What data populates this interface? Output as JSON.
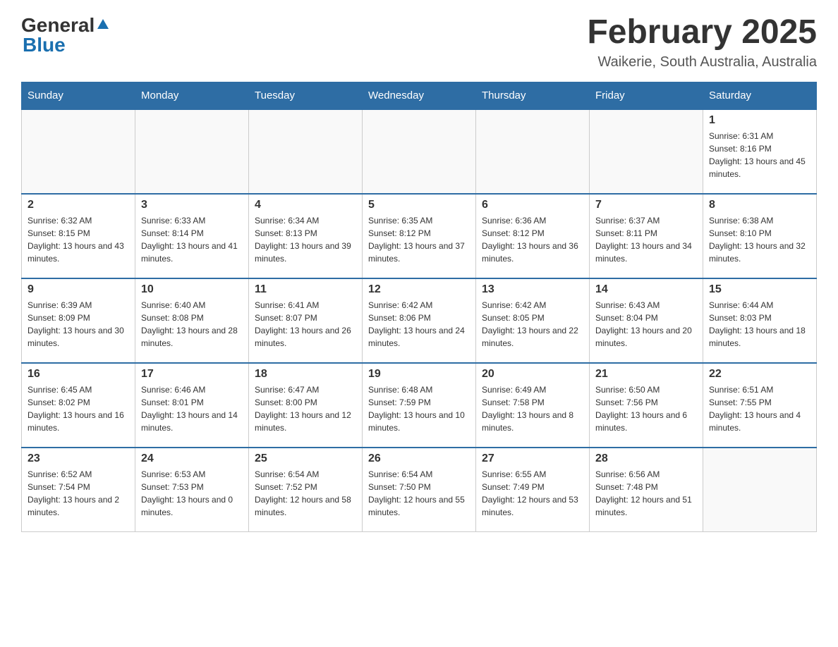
{
  "header": {
    "logo_general": "General",
    "logo_blue": "Blue",
    "month_title": "February 2025",
    "location": "Waikerie, South Australia, Australia"
  },
  "days_of_week": [
    "Sunday",
    "Monday",
    "Tuesday",
    "Wednesday",
    "Thursday",
    "Friday",
    "Saturday"
  ],
  "weeks": [
    [
      {
        "day": "",
        "info": ""
      },
      {
        "day": "",
        "info": ""
      },
      {
        "day": "",
        "info": ""
      },
      {
        "day": "",
        "info": ""
      },
      {
        "day": "",
        "info": ""
      },
      {
        "day": "",
        "info": ""
      },
      {
        "day": "1",
        "info": "Sunrise: 6:31 AM\nSunset: 8:16 PM\nDaylight: 13 hours and 45 minutes."
      }
    ],
    [
      {
        "day": "2",
        "info": "Sunrise: 6:32 AM\nSunset: 8:15 PM\nDaylight: 13 hours and 43 minutes."
      },
      {
        "day": "3",
        "info": "Sunrise: 6:33 AM\nSunset: 8:14 PM\nDaylight: 13 hours and 41 minutes."
      },
      {
        "day": "4",
        "info": "Sunrise: 6:34 AM\nSunset: 8:13 PM\nDaylight: 13 hours and 39 minutes."
      },
      {
        "day": "5",
        "info": "Sunrise: 6:35 AM\nSunset: 8:12 PM\nDaylight: 13 hours and 37 minutes."
      },
      {
        "day": "6",
        "info": "Sunrise: 6:36 AM\nSunset: 8:12 PM\nDaylight: 13 hours and 36 minutes."
      },
      {
        "day": "7",
        "info": "Sunrise: 6:37 AM\nSunset: 8:11 PM\nDaylight: 13 hours and 34 minutes."
      },
      {
        "day": "8",
        "info": "Sunrise: 6:38 AM\nSunset: 8:10 PM\nDaylight: 13 hours and 32 minutes."
      }
    ],
    [
      {
        "day": "9",
        "info": "Sunrise: 6:39 AM\nSunset: 8:09 PM\nDaylight: 13 hours and 30 minutes."
      },
      {
        "day": "10",
        "info": "Sunrise: 6:40 AM\nSunset: 8:08 PM\nDaylight: 13 hours and 28 minutes."
      },
      {
        "day": "11",
        "info": "Sunrise: 6:41 AM\nSunset: 8:07 PM\nDaylight: 13 hours and 26 minutes."
      },
      {
        "day": "12",
        "info": "Sunrise: 6:42 AM\nSunset: 8:06 PM\nDaylight: 13 hours and 24 minutes."
      },
      {
        "day": "13",
        "info": "Sunrise: 6:42 AM\nSunset: 8:05 PM\nDaylight: 13 hours and 22 minutes."
      },
      {
        "day": "14",
        "info": "Sunrise: 6:43 AM\nSunset: 8:04 PM\nDaylight: 13 hours and 20 minutes."
      },
      {
        "day": "15",
        "info": "Sunrise: 6:44 AM\nSunset: 8:03 PM\nDaylight: 13 hours and 18 minutes."
      }
    ],
    [
      {
        "day": "16",
        "info": "Sunrise: 6:45 AM\nSunset: 8:02 PM\nDaylight: 13 hours and 16 minutes."
      },
      {
        "day": "17",
        "info": "Sunrise: 6:46 AM\nSunset: 8:01 PM\nDaylight: 13 hours and 14 minutes."
      },
      {
        "day": "18",
        "info": "Sunrise: 6:47 AM\nSunset: 8:00 PM\nDaylight: 13 hours and 12 minutes."
      },
      {
        "day": "19",
        "info": "Sunrise: 6:48 AM\nSunset: 7:59 PM\nDaylight: 13 hours and 10 minutes."
      },
      {
        "day": "20",
        "info": "Sunrise: 6:49 AM\nSunset: 7:58 PM\nDaylight: 13 hours and 8 minutes."
      },
      {
        "day": "21",
        "info": "Sunrise: 6:50 AM\nSunset: 7:56 PM\nDaylight: 13 hours and 6 minutes."
      },
      {
        "day": "22",
        "info": "Sunrise: 6:51 AM\nSunset: 7:55 PM\nDaylight: 13 hours and 4 minutes."
      }
    ],
    [
      {
        "day": "23",
        "info": "Sunrise: 6:52 AM\nSunset: 7:54 PM\nDaylight: 13 hours and 2 minutes."
      },
      {
        "day": "24",
        "info": "Sunrise: 6:53 AM\nSunset: 7:53 PM\nDaylight: 13 hours and 0 minutes."
      },
      {
        "day": "25",
        "info": "Sunrise: 6:54 AM\nSunset: 7:52 PM\nDaylight: 12 hours and 58 minutes."
      },
      {
        "day": "26",
        "info": "Sunrise: 6:54 AM\nSunset: 7:50 PM\nDaylight: 12 hours and 55 minutes."
      },
      {
        "day": "27",
        "info": "Sunrise: 6:55 AM\nSunset: 7:49 PM\nDaylight: 12 hours and 53 minutes."
      },
      {
        "day": "28",
        "info": "Sunrise: 6:56 AM\nSunset: 7:48 PM\nDaylight: 12 hours and 51 minutes."
      },
      {
        "day": "",
        "info": ""
      }
    ]
  ]
}
